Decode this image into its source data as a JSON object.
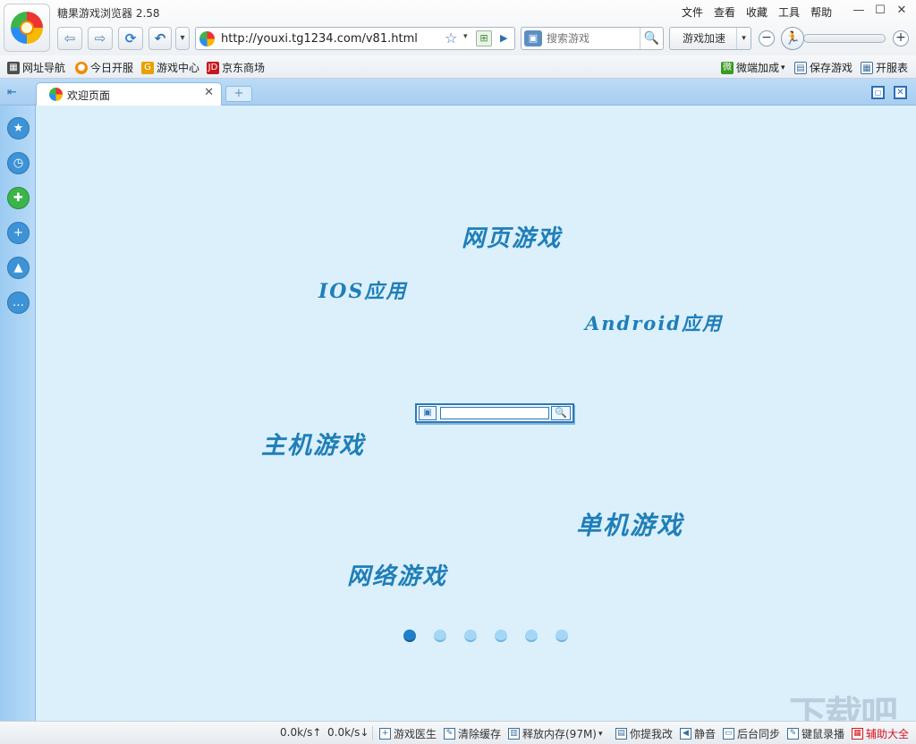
{
  "app": {
    "title": "糖果游戏浏览器 2.58",
    "menu": [
      "文件",
      "查看",
      "收藏",
      "工具",
      "帮助"
    ]
  },
  "window_controls": {
    "minimize": "—",
    "maximize": "☐",
    "close": "✕"
  },
  "nav": {
    "back": "⇦",
    "forward": "⇨",
    "refresh": "⟳",
    "undo": "↶",
    "dropdown": "▾",
    "url": "http://youxi.tg1234.com/v81.html",
    "star": "☆",
    "go": "▶"
  },
  "search": {
    "placeholder": "搜索游戏",
    "button": "🔍"
  },
  "speed": {
    "label": "游戏加速",
    "minus": "−",
    "plus": "+",
    "runner": "🏃"
  },
  "favorites": {
    "left": [
      {
        "label": "网址导航",
        "icon": "grid-icon",
        "color": "#4d4d4d"
      },
      {
        "label": "今日开服",
        "icon": "candy-icon",
        "color": "#f08a00"
      },
      {
        "label": "游戏中心",
        "icon": "g-icon",
        "color": "#e8a000"
      },
      {
        "label": "京东商场",
        "icon": "jd-icon",
        "color": "#c8161d"
      }
    ],
    "right": [
      {
        "label": "微端加成",
        "icon": "wei-icon",
        "color": "#3a9a22"
      },
      {
        "label": "保存游戏",
        "icon": "save-icon",
        "color": "#3d6e99"
      },
      {
        "label": "开服表",
        "icon": "table-icon",
        "color": "#3d6e99"
      }
    ]
  },
  "tabs": [
    {
      "label": "欢迎页面",
      "close": "✕"
    }
  ],
  "new_tab": "+",
  "sidebar": {
    "items": [
      {
        "name": "favorites-icon",
        "glyph": "★"
      },
      {
        "name": "history-icon",
        "glyph": "◷"
      },
      {
        "name": "gamepad-icon",
        "glyph": "✚"
      },
      {
        "name": "add-icon",
        "glyph": "+"
      },
      {
        "name": "broom-icon",
        "glyph": "▲"
      },
      {
        "name": "chat-icon",
        "glyph": "…"
      }
    ]
  },
  "content": {
    "categories": [
      {
        "label": "网页游戏",
        "name": "category-web-games"
      },
      {
        "label": "IOS应用",
        "name": "category-ios-apps"
      },
      {
        "label": "Android应用",
        "name": "category-android-apps"
      },
      {
        "label": "主机游戏",
        "name": "category-console-games"
      },
      {
        "label": "单机游戏",
        "name": "category-standalone-games"
      },
      {
        "label": "网络游戏",
        "name": "category-online-games"
      }
    ],
    "carousel_dots": 6,
    "active_dot": 0
  },
  "status": {
    "up": "0.0k/s↑",
    "down": "0.0k/s↓",
    "items": [
      "游戏医生",
      "清除缓存",
      "释放内存(97M)",
      "你提我改",
      "静音",
      "后台同步",
      "键鼠录播",
      "辅助大全"
    ]
  },
  "colors": {
    "accent": "#1f7fb8",
    "content_bg": "#dcf0fc",
    "tabbar": "#a7cdf0",
    "highlight_red": "#d6141b"
  }
}
